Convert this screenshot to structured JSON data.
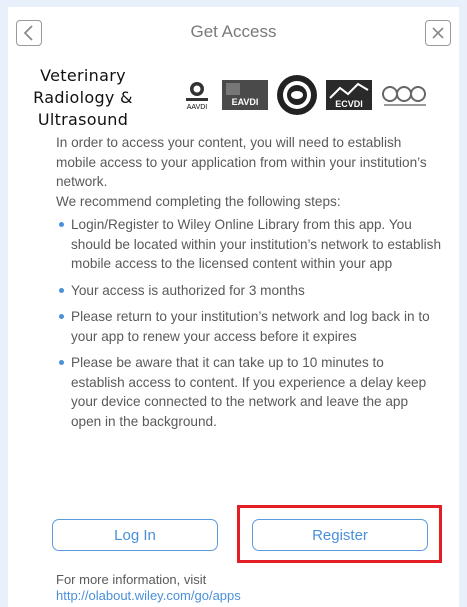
{
  "header": {
    "title": "Get Access",
    "back_icon": "chevron-left-icon",
    "close_icon": "close-x-icon"
  },
  "brand": {
    "journal_title_line1": "Veterinary",
    "journal_title_line2": "Radiology &",
    "journal_title_line3": "Ultrasound",
    "logos": [
      {
        "name": "aavdi-logo",
        "text": "AAVDI"
      },
      {
        "name": "eavdi-logo",
        "text": "EAVDI"
      },
      {
        "name": "seal-logo",
        "text": ""
      },
      {
        "name": "ecvdi-logo",
        "text": "ECVDI"
      },
      {
        "name": "ivra-logo",
        "text": ""
      }
    ]
  },
  "content": {
    "intro": "In order to access your content, you will need to establish mobile access to your application from within your institution’s network.",
    "recommend": "We recommend completing the following steps:",
    "steps": [
      "Login/Register to Wiley Online Library from this app. You should be located within your institution’s network to establish mobile access to the licensed content within your app",
      "Your access is authorized for 3 months",
      "Please return to your institution’s network and log back in to your app to renew your access before it expires",
      "Please be aware that it can take up to 10 minutes to establish access to content. If you experience a delay keep your device connected to the network and leave the app open in the background."
    ]
  },
  "actions": {
    "login_label": "Log In",
    "register_label": "Register"
  },
  "footer": {
    "info_text": "For more information, visit",
    "link_text": "http://olabout.wiley.com/go/apps"
  },
  "colors": {
    "accent": "#4a90d9",
    "highlight": "#e31e24",
    "text": "#5a5a5a"
  }
}
